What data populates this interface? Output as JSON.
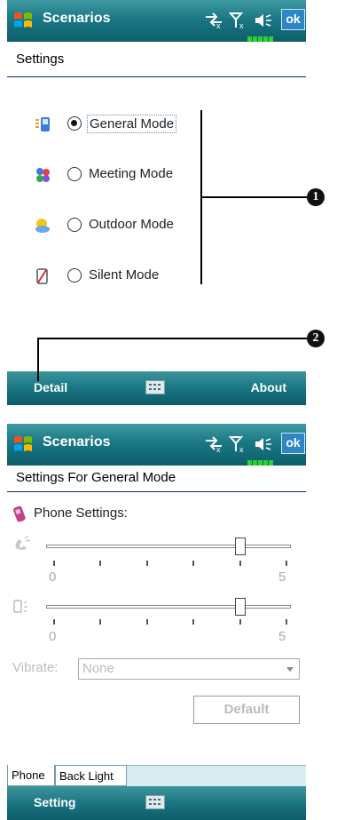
{
  "screen1": {
    "title": "Scenarios",
    "ok_label": "ok",
    "heading": "Settings",
    "modes": [
      {
        "label": "General Mode",
        "selected": true
      },
      {
        "label": "Meeting Mode",
        "selected": false
      },
      {
        "label": "Outdoor Mode",
        "selected": false
      },
      {
        "label": "Silent Mode",
        "selected": false
      }
    ],
    "menu": {
      "left": "Detail",
      "right": "About"
    },
    "callouts": [
      "1",
      "2"
    ]
  },
  "screen2": {
    "title": "Scenarios",
    "ok_label": "ok",
    "heading": "Settings For General Mode",
    "section_label": "Phone Settings:",
    "ringer_slider": {
      "min": "0",
      "max": "5",
      "value": 4
    },
    "volume_slider": {
      "min": "0",
      "max": "5",
      "value": 4
    },
    "vibrate_label": "Vibrate:",
    "vibrate_value": "None",
    "default_button": "Default",
    "tabs": [
      "Phone",
      "Back Light"
    ],
    "menu": {
      "left": "Setting"
    }
  },
  "colors": {
    "titlebar": "#1a7784",
    "accent_ok": "#2f86c6",
    "signal": "#2fd12f"
  }
}
